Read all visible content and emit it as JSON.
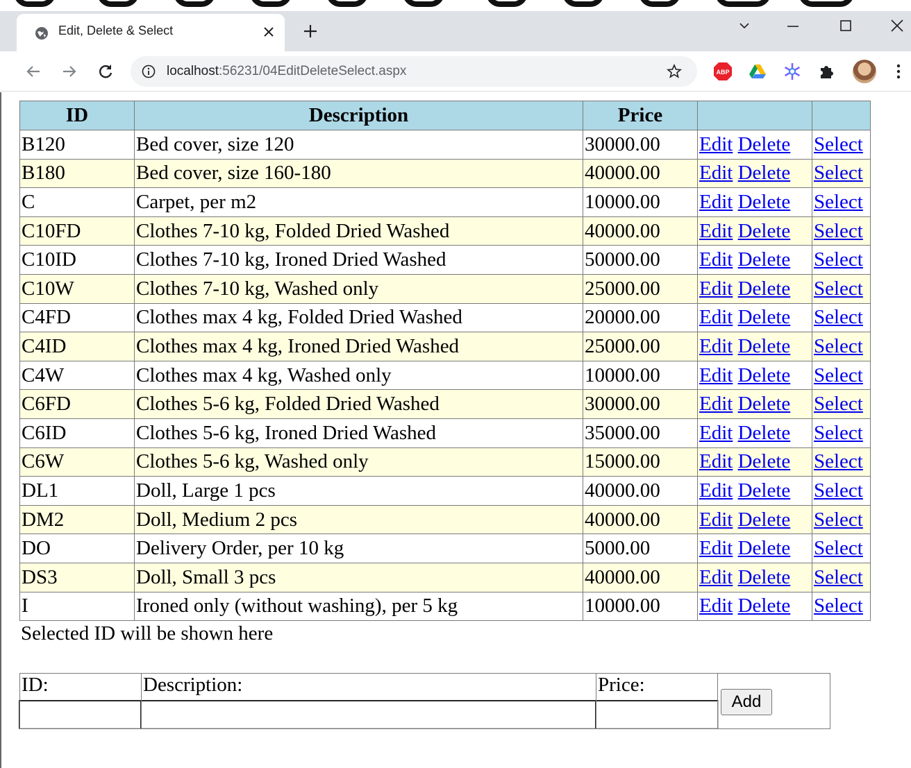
{
  "browser": {
    "tab_title": "Edit, Delete & Select",
    "url_host": "localhost",
    "url_path": ":56231/04EditDeleteSelect.aspx"
  },
  "grid": {
    "headers": [
      "ID",
      "Description",
      "Price",
      "",
      ""
    ],
    "link_edit": "Edit",
    "link_delete": "Delete",
    "link_select": "Select",
    "rows": [
      {
        "id": "B120",
        "description": "Bed cover, size 120",
        "price": "30000.00"
      },
      {
        "id": "B180",
        "description": "Bed cover, size 160-180",
        "price": "40000.00"
      },
      {
        "id": "C",
        "description": "Carpet, per m2",
        "price": "10000.00"
      },
      {
        "id": "C10FD",
        "description": "Clothes 7-10 kg, Folded Dried Washed",
        "price": "40000.00"
      },
      {
        "id": "C10ID",
        "description": "Clothes 7-10 kg, Ironed Dried Washed",
        "price": "50000.00"
      },
      {
        "id": "C10W",
        "description": "Clothes 7-10 kg, Washed only",
        "price": "25000.00"
      },
      {
        "id": "C4FD",
        "description": "Clothes max 4 kg, Folded Dried Washed",
        "price": "20000.00"
      },
      {
        "id": "C4ID",
        "description": "Clothes max 4 kg, Ironed Dried Washed",
        "price": "25000.00"
      },
      {
        "id": "C4W",
        "description": "Clothes max 4 kg, Washed only",
        "price": "10000.00"
      },
      {
        "id": "C6FD",
        "description": "Clothes 5-6 kg, Folded Dried Washed",
        "price": "30000.00"
      },
      {
        "id": "C6ID",
        "description": "Clothes 5-6 kg, Ironed Dried Washed",
        "price": "35000.00"
      },
      {
        "id": "C6W",
        "description": "Clothes 5-6 kg, Washed only",
        "price": "15000.00"
      },
      {
        "id": "DL1",
        "description": "Doll, Large 1 pcs",
        "price": "40000.00"
      },
      {
        "id": "DM2",
        "description": "Doll, Medium 2 pcs",
        "price": "40000.00"
      },
      {
        "id": "DO",
        "description": "Delivery Order, per 10 kg",
        "price": "5000.00"
      },
      {
        "id": "DS3",
        "description": "Doll, Small 3 pcs",
        "price": "40000.00"
      },
      {
        "id": "I",
        "description": "Ironed only (without washing), per 5 kg",
        "price": "10000.00"
      }
    ]
  },
  "selected_message": "Selected ID will be shown here",
  "form": {
    "id_label": "ID:",
    "description_label": "Description:",
    "price_label": "Price:",
    "id_value": "",
    "description_value": "",
    "price_value": "",
    "add_label": "Add"
  }
}
